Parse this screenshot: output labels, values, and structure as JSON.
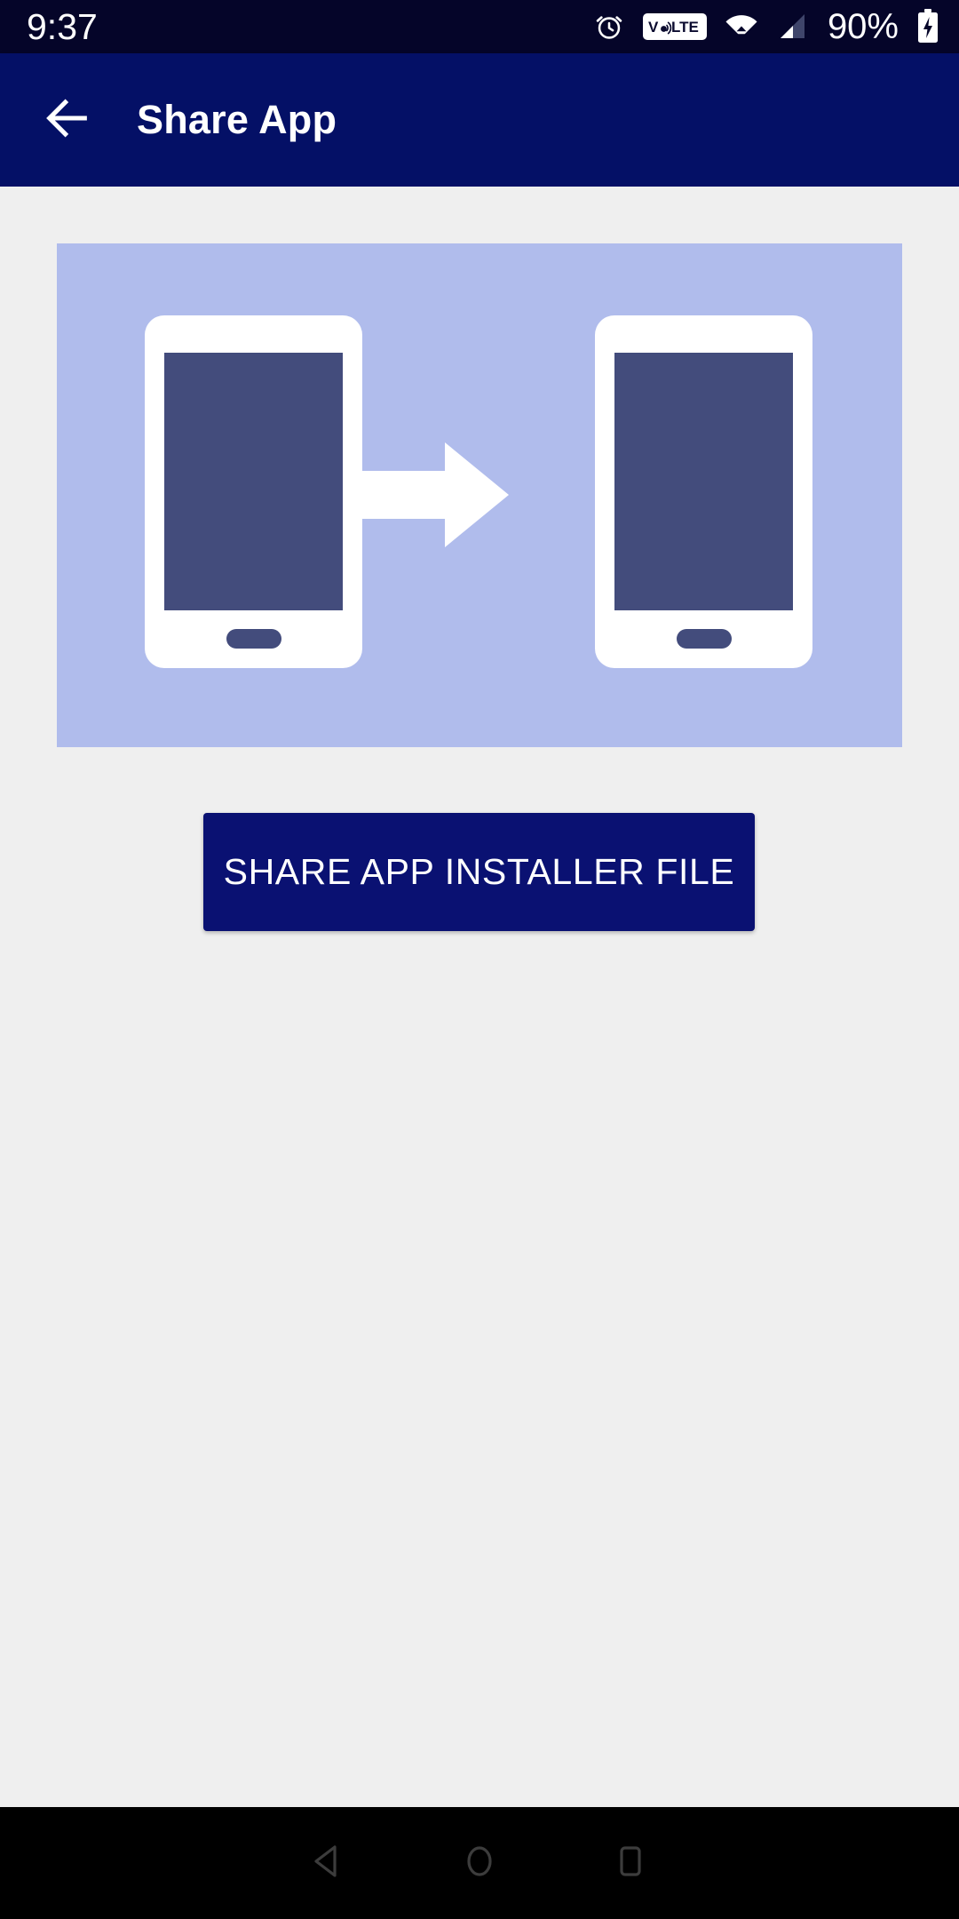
{
  "status_bar": {
    "time": "9:37",
    "battery_percent": "90%",
    "background_color": "#050529",
    "icons": [
      {
        "name": "alarm-icon",
        "label": "alarm"
      },
      {
        "name": "volte-icon",
        "label": "VoLTE"
      },
      {
        "name": "wifi-icon",
        "label": "wifi"
      },
      {
        "name": "cellular-signal-icon",
        "label": "signal"
      },
      {
        "name": "battery-charging-icon",
        "label": "charging"
      }
    ],
    "volte_text": "VoLTE"
  },
  "app_bar": {
    "title": "Share App",
    "back_icon": "arrow-left-icon",
    "background_color": "#041066",
    "text_color": "#ffffff"
  },
  "content": {
    "background_color": "#efefef",
    "illustration": {
      "name": "share-app-illustration",
      "panel_color": "#b0bcec",
      "phone_body_color": "#ffffff",
      "phone_screen_color": "#434c7c",
      "arrow_color": "#ffffff",
      "source_device_label": "source phone",
      "target_device_label": "target phone",
      "arrow_label": "transfer arrow"
    },
    "share_button": {
      "label": "SHARE APP INSTALLER FILE",
      "background_color": "#0a1172",
      "text_color": "#ffffff"
    }
  },
  "nav_bar": {
    "background_color": "#000000",
    "icon_color": "#3c3c3c",
    "keys": [
      {
        "name": "nav-back-button",
        "label": "Back"
      },
      {
        "name": "nav-home-button",
        "label": "Home"
      },
      {
        "name": "nav-recents-button",
        "label": "Recents"
      }
    ]
  }
}
